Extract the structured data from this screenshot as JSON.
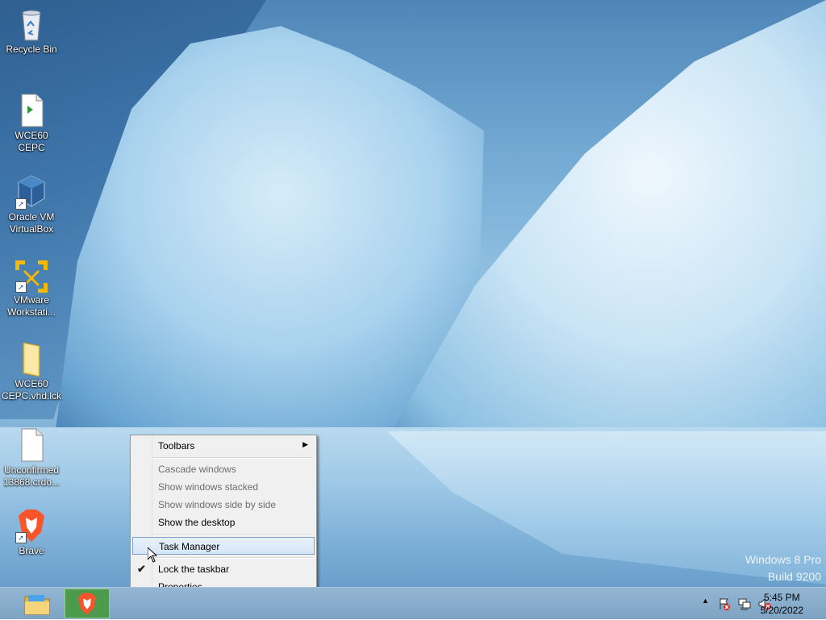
{
  "desktop": {
    "icons": [
      {
        "name": "Recycle Bin",
        "type": "recycle-bin-icon"
      },
      {
        "name": "WCE60 CEPC",
        "type": "file-icon"
      },
      {
        "name": "Oracle VM VirtualBox",
        "type": "virtualbox-icon"
      },
      {
        "name": "VMware Workstati...",
        "type": "vmware-icon"
      },
      {
        "name": "WCE60 CEPC.vhd.lck",
        "type": "folder-icon"
      },
      {
        "name": "Unconfirmed 13868.crdo...",
        "type": "blank-file-icon"
      },
      {
        "name": "Brave",
        "type": "brave-icon"
      }
    ]
  },
  "context_menu": {
    "items": [
      {
        "label": "Toolbars",
        "state": "enabled",
        "submenu": true
      },
      {
        "label": "Cascade windows",
        "state": "disabled"
      },
      {
        "label": "Show windows stacked",
        "state": "disabled"
      },
      {
        "label": "Show windows side by side",
        "state": "disabled"
      },
      {
        "label": "Show the desktop",
        "state": "enabled"
      },
      {
        "label": "Task Manager",
        "state": "highlighted"
      },
      {
        "label": "Lock the taskbar",
        "state": "checked"
      },
      {
        "label": "Properties",
        "state": "enabled"
      }
    ]
  },
  "watermark": {
    "line1": "Windows 8 Pro",
    "line2": "Build 9200"
  },
  "taskbar": {
    "pinned": [
      {
        "name": "File Explorer",
        "icon": "folder-icon"
      },
      {
        "name": "Brave",
        "icon": "brave-icon",
        "active": true
      }
    ],
    "tray_icons": [
      "show-hidden-icons-arrow",
      "action-center-flag-icon",
      "network-icon",
      "volume-muted-icon"
    ],
    "clock": {
      "time": "5:45 PM",
      "date": "5/20/2022"
    }
  },
  "colors": {
    "taskbar": "#7ea3c3",
    "menu_background": "#f0f0f0",
    "menu_highlight": "#d6e6f7",
    "brave_orange": "#fb542b",
    "vmware_yellow": "#f5b800"
  }
}
